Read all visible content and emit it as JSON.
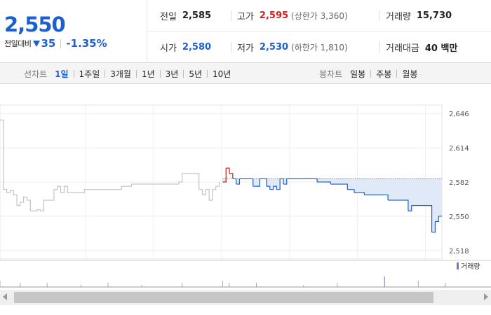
{
  "summary": {
    "current_price": "2,550",
    "change_label": "전일대비",
    "change_direction_icon": "down-triangle-icon",
    "change_value": "35",
    "change_rate": "-1.35%",
    "prev_close_label": "전일",
    "prev_close": "2,585",
    "open_label": "시가",
    "open": "2,580",
    "high_label": "고가",
    "high": "2,595",
    "upper_limit": "(상한가 3,360)",
    "low_label": "저가",
    "low": "2,530",
    "lower_limit": "(하한가 1,810)",
    "volume_label": "거래량",
    "volume": "15,730",
    "amount_label": "거래대금",
    "amount": "40 백만"
  },
  "toolbar": {
    "line_chart_label": "선차트",
    "line_periods": [
      "1일",
      "1주일",
      "3개월",
      "1년",
      "3년",
      "5년",
      "10년"
    ],
    "active_period": "1일",
    "candle_chart_label": "봉차트",
    "candle_periods": [
      "일봉",
      "주봉",
      "월봉"
    ]
  },
  "chart_data": {
    "type": "line",
    "ylim": [
      2510,
      2654
    ],
    "y_ticks": [
      "2,646",
      "2,614",
      "2,582",
      "2,550",
      "2,518"
    ],
    "y_tick_values": [
      2646,
      2614,
      2582,
      2550,
      2518
    ],
    "reference_line": 2585,
    "volume_legend": "거래량",
    "series": [
      {
        "style": "previous-day",
        "x": [
          0,
          1,
          2,
          3,
          4,
          5,
          6,
          7,
          8,
          9,
          10,
          11,
          12,
          13,
          14,
          15,
          16,
          17,
          18,
          19,
          20,
          21,
          22,
          23,
          24,
          25,
          26,
          27,
          28,
          29,
          30,
          31,
          32,
          33,
          34,
          35,
          36,
          37,
          38,
          39,
          40,
          41,
          42,
          43,
          44,
          45,
          46,
          47,
          48,
          49,
          50,
          51,
          52,
          53,
          54,
          55,
          56,
          57,
          58,
          59,
          60,
          61,
          62,
          63,
          64,
          65
        ],
        "y": [
          2640,
          2575,
          2572,
          2574,
          2570,
          2560,
          2563,
          2568,
          2565,
          2555,
          2555,
          2556,
          2555,
          2565,
          2565,
          2565,
          2575,
          2578,
          2572,
          2578,
          2572,
          2572,
          2572,
          2572,
          2572,
          2575,
          2575,
          2575,
          2575,
          2575,
          2575,
          2575,
          2575,
          2575,
          2575,
          2575,
          2578,
          2578,
          2578,
          2580,
          2580,
          2580,
          2580,
          2580,
          2580,
          2580,
          2580,
          2580,
          2580,
          2580,
          2580,
          2580,
          2580,
          2582,
          2590,
          2590,
          2590,
          2590,
          2590,
          2575,
          2570,
          2575,
          2565,
          2575,
          2578,
          2582
        ]
      },
      {
        "style": "today",
        "color": "#1e5fd0",
        "color_up": "#d11f1f",
        "colors": [
          "#1e5fd0",
          "#d11f1f"
        ],
        "x": [
          66,
          67,
          68,
          69,
          70,
          71,
          72,
          73,
          74,
          75,
          76,
          77,
          78,
          79,
          80,
          81,
          82,
          83,
          84,
          85,
          86,
          87,
          88,
          89,
          90,
          91,
          92,
          93,
          94,
          95,
          96,
          97,
          98,
          99,
          100,
          101,
          102,
          103,
          104,
          105,
          106,
          107,
          108,
          109,
          110,
          111,
          112,
          113,
          114,
          115,
          116,
          117,
          118,
          119,
          120,
          121,
          122,
          123,
          124,
          125,
          126,
          127,
          128,
          129,
          130,
          131
        ],
        "y": [
          2582,
          2595,
          2590,
          2585,
          2580,
          2585,
          2585,
          2585,
          2585,
          2578,
          2578,
          2585,
          2585,
          2578,
          2575,
          2578,
          2575,
          2585,
          2580,
          2585,
          2585,
          2585,
          2585,
          2585,
          2585,
          2585,
          2585,
          2585,
          2582,
          2582,
          2582,
          2582,
          2580,
          2580,
          2580,
          2580,
          2580,
          2575,
          2575,
          2572,
          2572,
          2572,
          2570,
          2570,
          2570,
          2570,
          2570,
          2570,
          2570,
          2565,
          2565,
          2565,
          2565,
          2565,
          2565,
          2555,
          2560,
          2560,
          2560,
          2560,
          2560,
          2560,
          2535,
          2545,
          2550,
          2550
        ]
      }
    ],
    "volume": {
      "x": [
        0,
        6,
        14,
        24,
        32,
        42,
        54,
        66,
        68,
        76,
        90,
        100,
        114,
        124,
        132
      ],
      "y": [
        3,
        2,
        2,
        1,
        2,
        1,
        2,
        3,
        2,
        2,
        1,
        2,
        5,
        3,
        2
      ]
    }
  }
}
